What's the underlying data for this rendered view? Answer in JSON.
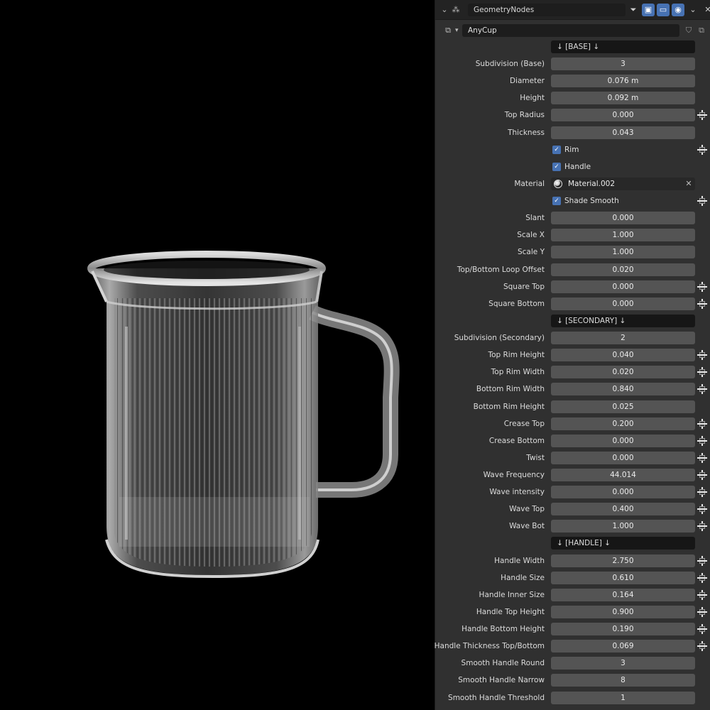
{
  "header": {
    "node_group": "GeometryNodes",
    "modifier_name": "AnyCup"
  },
  "rows": [
    {
      "type": "section",
      "value": "↓ [BASE] ↓"
    },
    {
      "type": "field",
      "label": "Subdivision (Base)",
      "value": "3",
      "key": false
    },
    {
      "type": "field",
      "label": "Diameter",
      "value": "0.076 m",
      "key": false
    },
    {
      "type": "field",
      "label": "Height",
      "value": "0.092 m",
      "key": false
    },
    {
      "type": "field",
      "label": "Top Radius",
      "value": "0.000",
      "key": true
    },
    {
      "type": "field",
      "label": "Thickness",
      "value": "0.043",
      "key": false
    },
    {
      "type": "check",
      "text": "Rim",
      "key": true
    },
    {
      "type": "check",
      "text": "Handle",
      "key": false
    },
    {
      "type": "material",
      "label": "Material",
      "value": "Material.002",
      "key": false
    },
    {
      "type": "check",
      "text": "Shade Smooth",
      "key": true
    },
    {
      "type": "field",
      "label": "Slant",
      "value": "0.000",
      "key": false
    },
    {
      "type": "field",
      "label": "Scale X",
      "value": "1.000",
      "key": false
    },
    {
      "type": "field",
      "label": "Scale Y",
      "value": "1.000",
      "key": false
    },
    {
      "type": "field",
      "label": "Top/Bottom Loop Offset",
      "value": "0.020",
      "key": false
    },
    {
      "type": "field",
      "label": "Square Top",
      "value": "0.000",
      "key": true
    },
    {
      "type": "field",
      "label": "Square Bottom",
      "value": "0.000",
      "key": true
    },
    {
      "type": "section",
      "value": "↓ [SECONDARY] ↓"
    },
    {
      "type": "field",
      "label": "Subdivision (Secondary)",
      "value": "2",
      "key": false
    },
    {
      "type": "field",
      "label": "Top Rim Height",
      "value": "0.040",
      "key": true
    },
    {
      "type": "field",
      "label": "Top Rim Width",
      "value": "0.020",
      "key": true
    },
    {
      "type": "field",
      "label": "Bottom Rim Width",
      "value": "0.840",
      "key": true
    },
    {
      "type": "field",
      "label": "Bottom Rim Height",
      "value": "0.025",
      "key": false
    },
    {
      "type": "field",
      "label": "Crease Top",
      "value": "0.200",
      "key": true
    },
    {
      "type": "field",
      "label": "Crease Bottom",
      "value": "0.000",
      "key": true
    },
    {
      "type": "field",
      "label": "Twist",
      "value": "0.000",
      "key": true
    },
    {
      "type": "field",
      "label": "Wave Frequency",
      "value": "44.014",
      "key": true
    },
    {
      "type": "field",
      "label": "Wave intensity",
      "value": "0.000",
      "key": true
    },
    {
      "type": "field",
      "label": "Wave Top",
      "value": "0.400",
      "key": true
    },
    {
      "type": "field",
      "label": "Wave Bot",
      "value": "1.000",
      "key": true
    },
    {
      "type": "section",
      "value": "↓ [HANDLE] ↓"
    },
    {
      "type": "field",
      "label": "Handle Width",
      "value": "2.750",
      "key": true
    },
    {
      "type": "field",
      "label": "Handle Size",
      "value": "0.610",
      "key": true
    },
    {
      "type": "field",
      "label": "Handle Inner Size",
      "value": "0.164",
      "key": true
    },
    {
      "type": "field",
      "label": "Handle Top Height",
      "value": "0.900",
      "key": true
    },
    {
      "type": "field",
      "label": "Handle Bottom Height",
      "value": "0.190",
      "key": true
    },
    {
      "type": "field",
      "label": "Handle Thickness Top/Bottom",
      "value": "0.069",
      "key": true
    },
    {
      "type": "field",
      "label": "Smooth Handle Round",
      "value": "3",
      "key": false
    },
    {
      "type": "field",
      "label": "Smooth Handle Narrow",
      "value": "8",
      "key": false
    },
    {
      "type": "field",
      "label": "Smooth Handle Threshold",
      "value": "1",
      "key": false
    }
  ]
}
